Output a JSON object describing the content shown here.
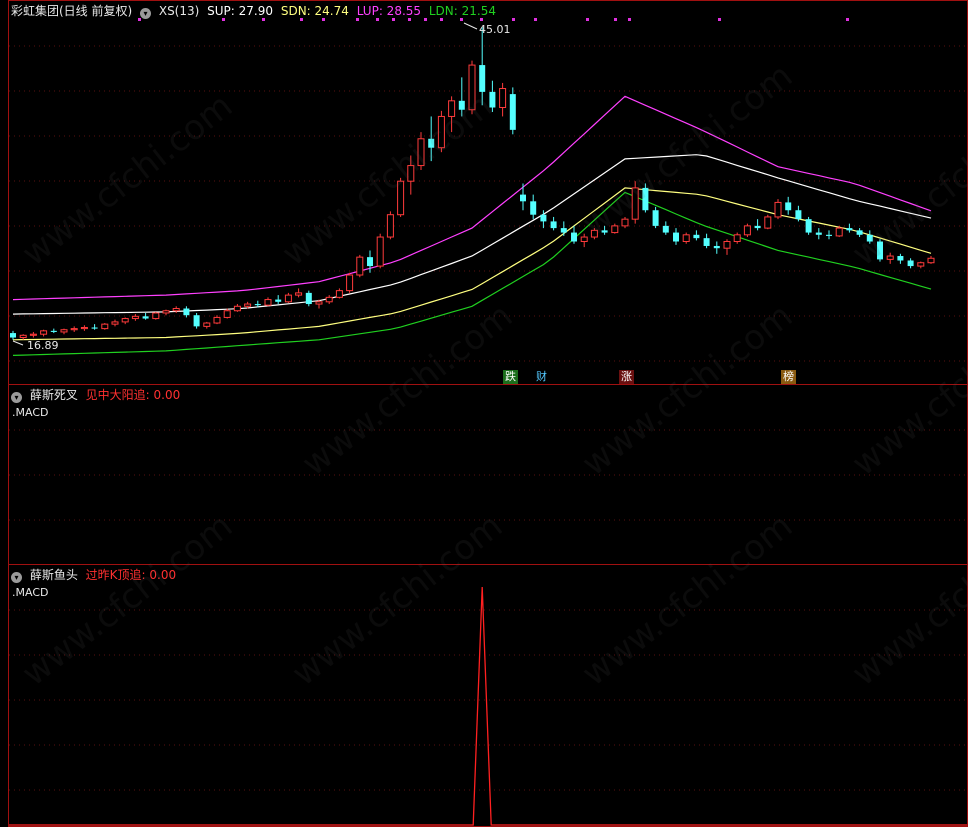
{
  "main_panel": {
    "title": "彩虹集团(日线 前复权)",
    "indicator_name": "XS(13)",
    "sup": "SUP: 27.90",
    "sdn": "SDN: 24.74",
    "lup": "LUP: 28.55",
    "ldn": "LDN: 21.54",
    "high_label": "45.01",
    "low_label": "16.89",
    "events": [
      "跌",
      "财",
      "涨",
      "榜"
    ]
  },
  "panel2": {
    "name": "薛斯死叉",
    "signal": "见中大阳追: 0.00",
    "sub": ".MACD"
  },
  "panel3": {
    "name": "薛斯鱼头",
    "signal": "过昨K顶追: 0.00",
    "sub": ".MACD"
  },
  "watermark": "www.cfchi.com",
  "colors": {
    "up": "#ff3b3b",
    "down": "#54ffff",
    "sup": "#ffffff",
    "sdn": "#ffff80",
    "lup": "#ff40ff",
    "ldn": "#20d020",
    "frame": "#a01010",
    "signal": "#ff2020"
  },
  "chart_data": {
    "type": "candlestick",
    "y_range": [
      16.89,
      45.01
    ],
    "candles": [
      [
        17.6,
        17.8,
        17.0,
        17.2
      ],
      [
        17.2,
        17.5,
        17.0,
        17.4
      ],
      [
        17.4,
        17.7,
        17.2,
        17.5
      ],
      [
        17.5,
        17.9,
        17.3,
        17.8
      ],
      [
        17.8,
        18.0,
        17.6,
        17.7
      ],
      [
        17.7,
        18.0,
        17.5,
        17.9
      ],
      [
        17.9,
        18.2,
        17.7,
        18.0
      ],
      [
        18.0,
        18.3,
        17.8,
        18.1
      ],
      [
        18.1,
        18.4,
        17.9,
        18.0
      ],
      [
        18.0,
        18.5,
        17.9,
        18.4
      ],
      [
        18.4,
        18.8,
        18.2,
        18.6
      ],
      [
        18.6,
        19.0,
        18.4,
        18.9
      ],
      [
        18.9,
        19.3,
        18.7,
        19.1
      ],
      [
        19.1,
        19.4,
        18.8,
        18.9
      ],
      [
        18.9,
        19.5,
        18.8,
        19.4
      ],
      [
        19.4,
        19.7,
        19.2,
        19.6
      ],
      [
        19.6,
        20.0,
        19.4,
        19.8
      ],
      [
        19.8,
        20.0,
        19.0,
        19.2
      ],
      [
        19.2,
        19.4,
        18.0,
        18.2
      ],
      [
        18.2,
        18.6,
        18.0,
        18.5
      ],
      [
        18.5,
        19.2,
        18.4,
        19.0
      ],
      [
        19.0,
        19.8,
        18.9,
        19.6
      ],
      [
        19.6,
        20.2,
        19.5,
        20.0
      ],
      [
        20.0,
        20.4,
        19.8,
        20.2
      ],
      [
        20.2,
        20.5,
        19.9,
        20.1
      ],
      [
        20.1,
        20.8,
        20.0,
        20.6
      ],
      [
        20.6,
        21.0,
        20.2,
        20.4
      ],
      [
        20.4,
        21.2,
        20.3,
        21.0
      ],
      [
        21.0,
        21.6,
        20.8,
        21.2
      ],
      [
        21.2,
        21.4,
        20.0,
        20.2
      ],
      [
        20.2,
        20.6,
        19.8,
        20.4
      ],
      [
        20.4,
        21.0,
        20.2,
        20.8
      ],
      [
        20.8,
        21.6,
        20.7,
        21.4
      ],
      [
        21.4,
        23.0,
        21.2,
        22.8
      ],
      [
        22.8,
        24.6,
        22.6,
        24.4
      ],
      [
        24.4,
        25.0,
        23.0,
        23.6
      ],
      [
        23.6,
        26.5,
        23.4,
        26.2
      ],
      [
        26.2,
        28.5,
        26.0,
        28.2
      ],
      [
        28.2,
        31.5,
        28.0,
        31.2
      ],
      [
        31.2,
        33.5,
        30.0,
        32.6
      ],
      [
        32.6,
        35.6,
        32.2,
        35.0
      ],
      [
        35.0,
        37.0,
        33.0,
        34.2
      ],
      [
        34.2,
        37.5,
        33.8,
        37.0
      ],
      [
        37.0,
        38.8,
        35.6,
        38.4
      ],
      [
        38.4,
        40.5,
        37.0,
        37.6
      ],
      [
        37.6,
        42.0,
        37.2,
        41.6
      ],
      [
        41.6,
        45.01,
        38.0,
        39.2
      ],
      [
        39.2,
        40.2,
        37.4,
        37.8
      ],
      [
        37.8,
        40.0,
        37.0,
        39.5
      ],
      [
        39.0,
        39.6,
        35.4,
        35.8
      ],
      [
        30.0,
        31.0,
        28.6,
        29.4
      ],
      [
        29.4,
        30.0,
        27.8,
        28.2
      ],
      [
        28.2,
        28.6,
        27.0,
        27.6
      ],
      [
        27.6,
        28.0,
        26.8,
        27.0
      ],
      [
        27.0,
        27.6,
        26.3,
        26.6
      ],
      [
        26.6,
        27.2,
        25.6,
        25.8
      ],
      [
        25.8,
        26.5,
        25.3,
        26.2
      ],
      [
        26.2,
        27.0,
        26.0,
        26.8
      ],
      [
        26.8,
        27.2,
        26.4,
        26.6
      ],
      [
        26.6,
        27.4,
        26.5,
        27.2
      ],
      [
        27.2,
        28.0,
        27.0,
        27.8
      ],
      [
        27.8,
        31.2,
        27.4,
        30.6
      ],
      [
        30.6,
        31.0,
        28.4,
        28.6
      ],
      [
        28.6,
        28.9,
        27.0,
        27.2
      ],
      [
        27.2,
        27.6,
        26.4,
        26.6
      ],
      [
        26.6,
        27.0,
        25.5,
        25.8
      ],
      [
        25.8,
        26.6,
        25.6,
        26.4
      ],
      [
        26.4,
        26.8,
        25.9,
        26.1
      ],
      [
        26.1,
        26.5,
        25.2,
        25.4
      ],
      [
        25.4,
        25.8,
        24.7,
        25.2
      ],
      [
        25.2,
        26.0,
        24.6,
        25.8
      ],
      [
        25.8,
        26.6,
        25.6,
        26.4
      ],
      [
        26.4,
        27.4,
        26.2,
        27.2
      ],
      [
        27.2,
        27.8,
        26.8,
        27.0
      ],
      [
        27.0,
        28.2,
        26.9,
        28.0
      ],
      [
        28.0,
        29.6,
        27.8,
        29.3
      ],
      [
        29.3,
        29.8,
        28.2,
        28.6
      ],
      [
        28.6,
        29.0,
        27.6,
        27.8
      ],
      [
        27.8,
        28.0,
        26.4,
        26.6
      ],
      [
        26.6,
        27.0,
        26.0,
        26.4
      ],
      [
        26.4,
        26.8,
        26.0,
        26.3
      ],
      [
        26.3,
        27.2,
        26.2,
        27.0
      ],
      [
        27.0,
        27.4,
        26.6,
        26.8
      ],
      [
        26.8,
        27.0,
        26.2,
        26.4
      ],
      [
        26.4,
        26.8,
        25.6,
        25.8
      ],
      [
        25.8,
        26.0,
        24.0,
        24.2
      ],
      [
        24.2,
        24.8,
        23.8,
        24.5
      ],
      [
        24.5,
        24.7,
        23.8,
        24.1
      ],
      [
        24.1,
        24.3,
        23.4,
        23.6
      ],
      [
        23.6,
        24.0,
        23.4,
        23.9
      ],
      [
        23.9,
        24.5,
        23.8,
        24.3
      ]
    ],
    "sup_line": [
      19.3,
      19.4,
      19.5,
      19.8,
      20.5,
      22.0,
      24.5,
      28.5,
      33.2,
      33.6,
      31.5,
      29.5,
      27.9
    ],
    "sdn_line": [
      17.0,
      17.1,
      17.2,
      17.6,
      18.2,
      19.4,
      21.5,
      25.5,
      30.6,
      30.0,
      28.2,
      26.8,
      24.74
    ],
    "lup_line": [
      20.6,
      20.8,
      21.0,
      21.4,
      22.2,
      24.0,
      27.0,
      32.5,
      38.8,
      35.8,
      32.5,
      31.0,
      28.55
    ],
    "ldn_line": [
      15.6,
      15.8,
      16.0,
      16.5,
      17.0,
      18.0,
      20.0,
      24.0,
      30.2,
      27.3,
      25.0,
      23.5,
      21.54
    ],
    "signal3_spike_index": 46
  }
}
